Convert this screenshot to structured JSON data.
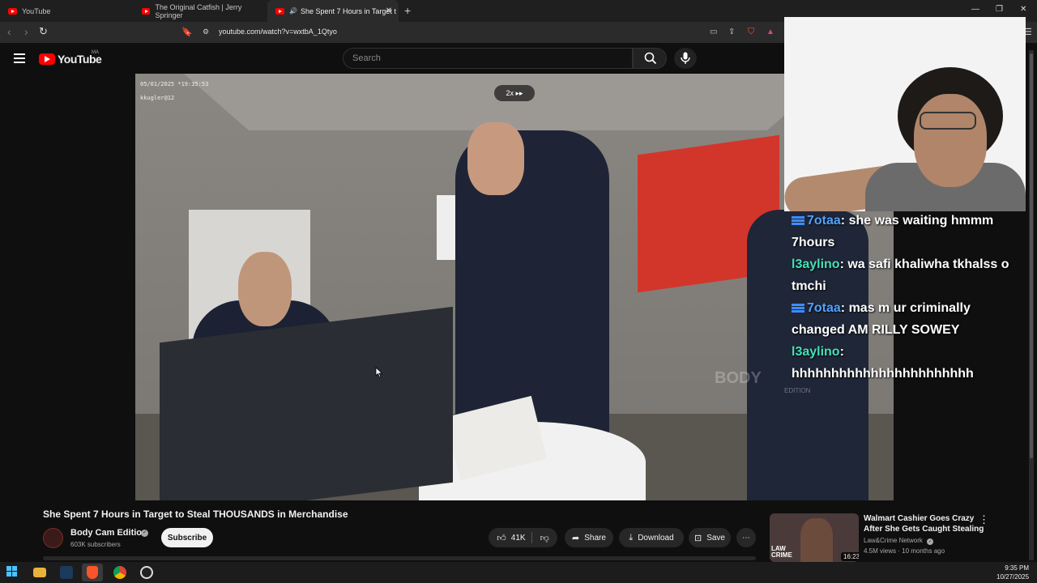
{
  "browser": {
    "tabs": [
      {
        "label": "YouTube"
      },
      {
        "label": "The Original Catfish | Jerry Springer"
      },
      {
        "label": "She Spent 7 Hours in Target t"
      }
    ],
    "new_tab": "+",
    "url": "youtube.com/watch?v=wxtbA_1Qtyo"
  },
  "youtube": {
    "logo_text": "YouTube",
    "country_code": "MA",
    "search_placeholder": "Search"
  },
  "video": {
    "timestamp": "05/01/2025 *19:35:53",
    "camera_id": "kkugler@12",
    "speed_badge": "2x ▸▸",
    "watermark": "BODY",
    "watermark_sub": "EDITION"
  },
  "chat": {
    "messages": [
      {
        "user": "7otaa",
        "text": " she was waiting hmmm 7hours",
        "badge": true
      },
      {
        "user": "l3aylino",
        "text": " wa safi khaliwha tkhalss o tmchi",
        "badge": false
      },
      {
        "user": "7otaa",
        "text": " mas m ur criminally changed AM RILLY SOWEY",
        "badge": true
      },
      {
        "user": "l3aylino",
        "text": " hhhhhhhhhhhhhhhhhhhhhhh",
        "badge": false
      }
    ]
  },
  "details": {
    "title": "She Spent 7 Hours in Target to Steal THOUSANDS in Merchandise",
    "channel": "Body Cam Edition",
    "subscribers": "603K subscribers",
    "subscribe_label": "Subscribe",
    "likes": "41K",
    "share_label": "Share",
    "download_label": "Download",
    "save_label": "Save"
  },
  "recommended": {
    "title": "Walmart Cashier Goes Crazy After She Gets Caught Stealing",
    "channel": "Law&Crime Network",
    "meta": "4.5M views · 10 months ago",
    "duration": "16:23",
    "thumb_text": "LAW CRIME"
  },
  "taskbar": {
    "time": "9:35 PM",
    "date": "10/27/2025"
  }
}
